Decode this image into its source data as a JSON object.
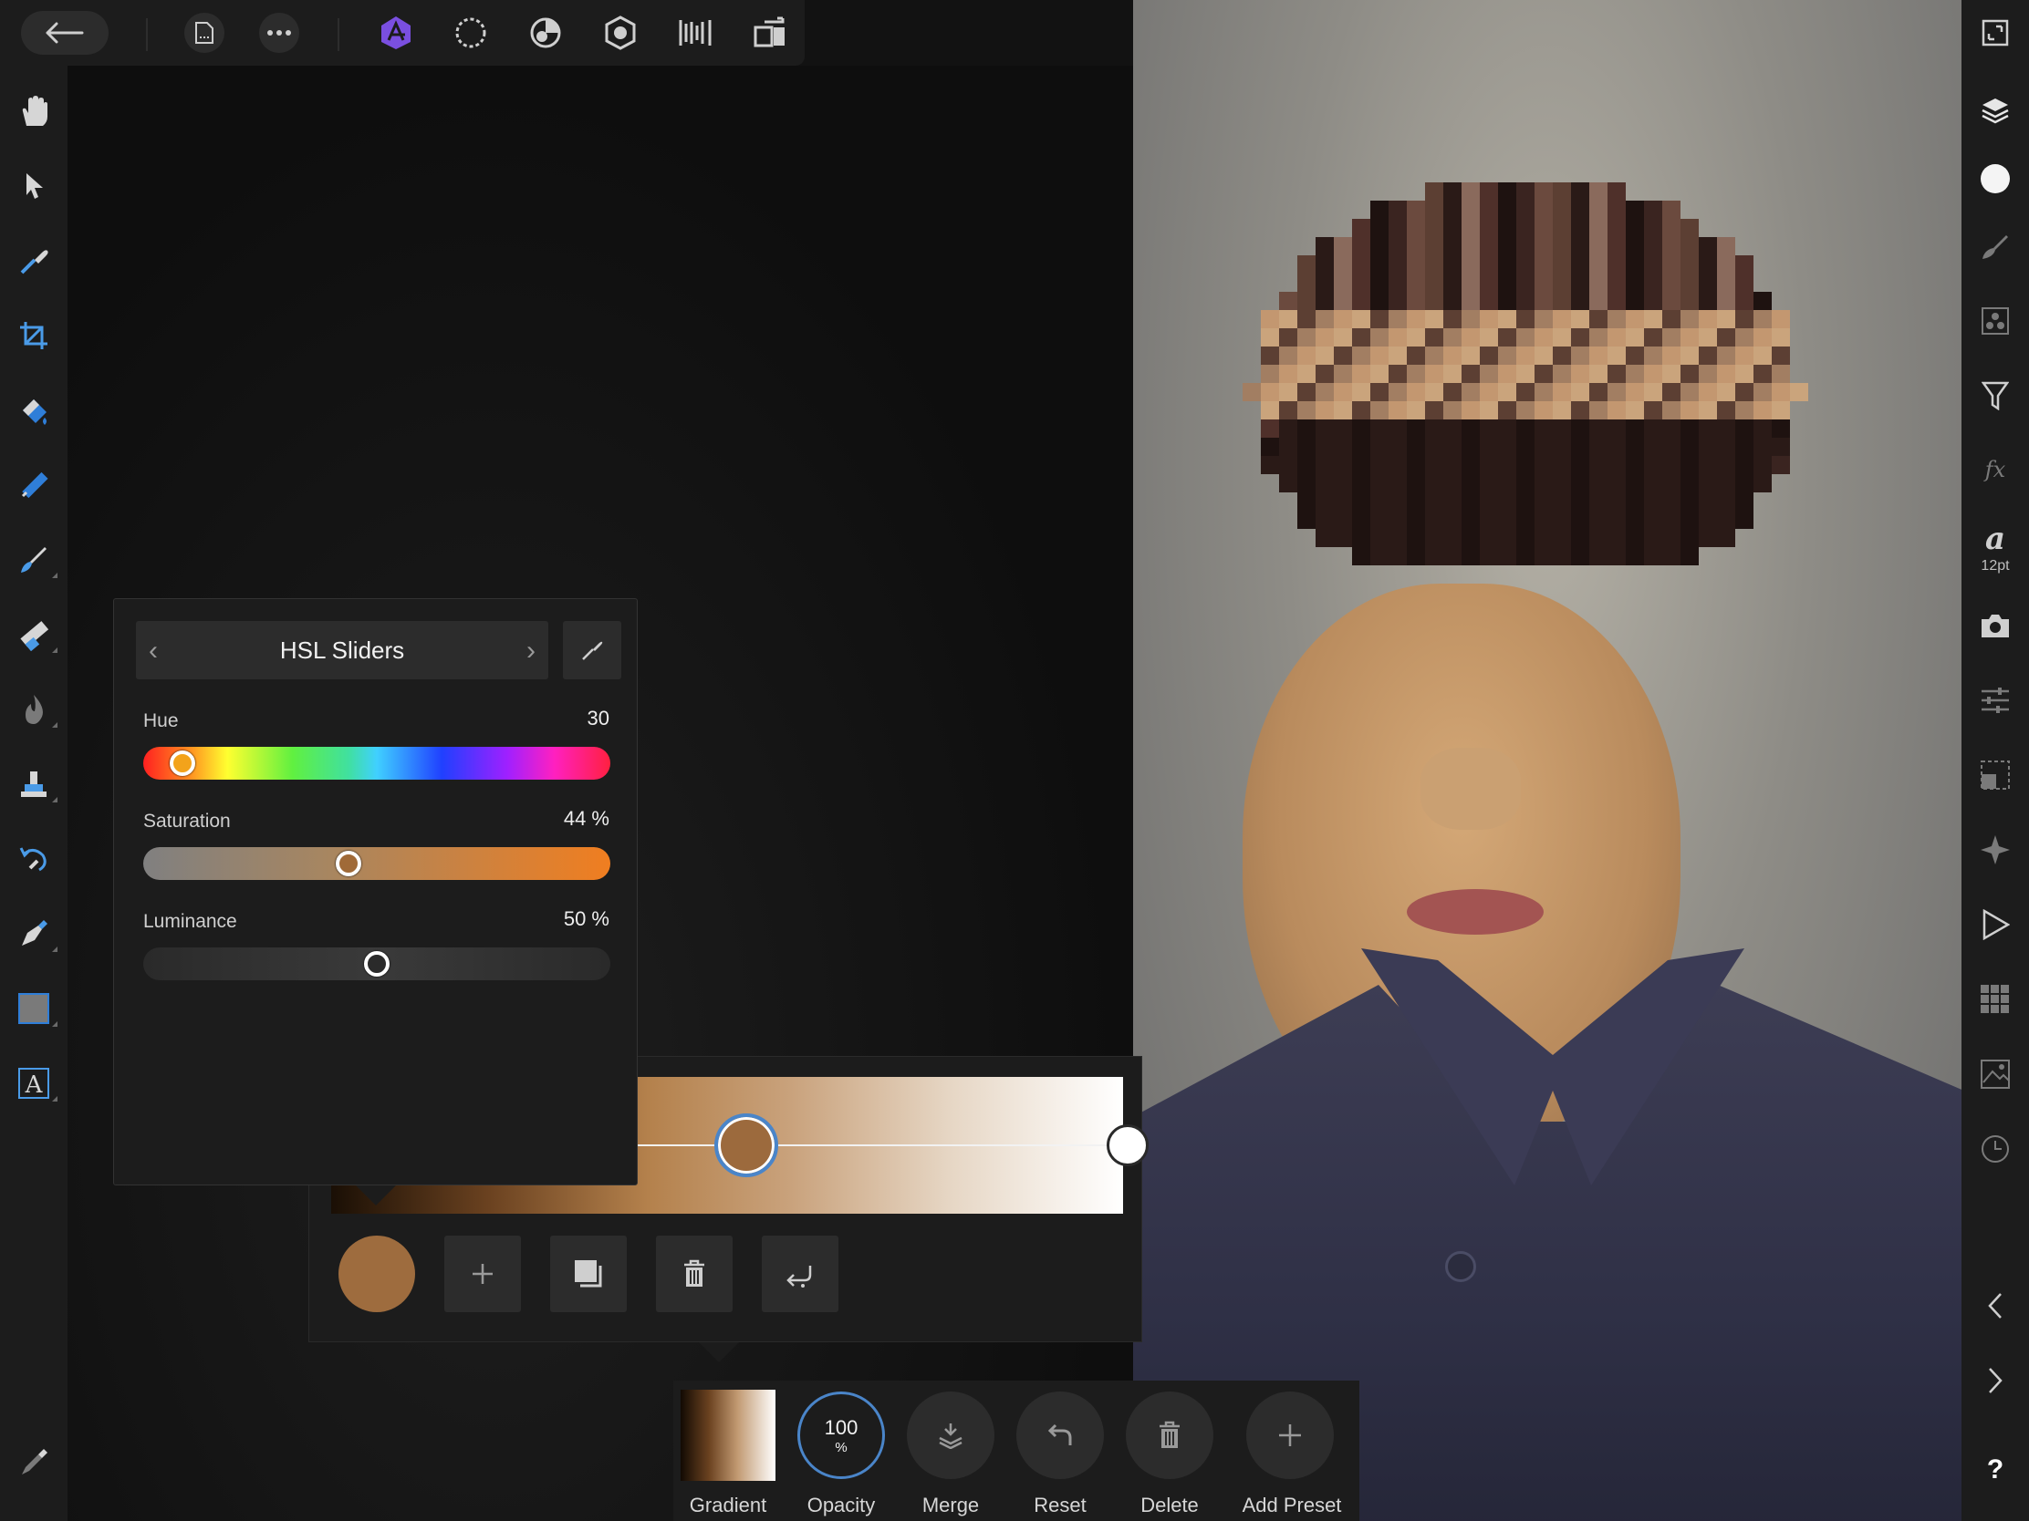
{
  "hsl_panel": {
    "title": "HSL Sliders",
    "hue": {
      "label": "Hue",
      "value": "30",
      "level": 30
    },
    "saturation": {
      "label": "Saturation",
      "value": "44 %",
      "level": 44
    },
    "luminance": {
      "label": "Luminance",
      "value": "50 %",
      "level": 50
    }
  },
  "bottom_bar": {
    "gradient_label": "Gradient",
    "opacity_value": "100",
    "opacity_unit": "%",
    "opacity_label": "Opacity",
    "merge_label": "Merge",
    "reset_label": "Reset",
    "delete_label": "Delete",
    "add_preset_label": "Add Preset"
  },
  "right_toolbar": {
    "text_size": "12pt",
    "help": "?"
  },
  "colors": {
    "accent": "#7a4fe0",
    "selected_color": "#9e6c3e",
    "stop_border": "#4a85c9"
  },
  "icons": {
    "top": [
      "back-arrow-icon",
      "document-icon",
      "more-icon",
      "photo-persona-icon",
      "liquify-persona-icon",
      "develop-persona-icon",
      "tone-mapping-persona-icon",
      "export-persona-icon",
      "share-icon"
    ],
    "left": [
      "hand-icon",
      "move-icon",
      "color-picker-icon",
      "crop-icon",
      "flood-fill-icon",
      "gradient-icon",
      "paint-brush-icon",
      "erase-brush-icon",
      "dodge-icon",
      "clone-icon",
      "undo-brush-icon",
      "pen-icon",
      "rectangle-icon",
      "text-icon",
      "settings-icon"
    ],
    "right": [
      "fit-icon",
      "layers-icon",
      "color-icon",
      "brushes-icon",
      "channels-icon",
      "filters-icon",
      "fx-icon",
      "text-style-icon",
      "camera-icon",
      "adjustments-icon",
      "transform-icon",
      "navigator-icon",
      "macro-icon",
      "stock-icon",
      "image-icon",
      "history-icon",
      "collapse-left-icon",
      "expand-right-icon",
      "help-icon"
    ]
  }
}
